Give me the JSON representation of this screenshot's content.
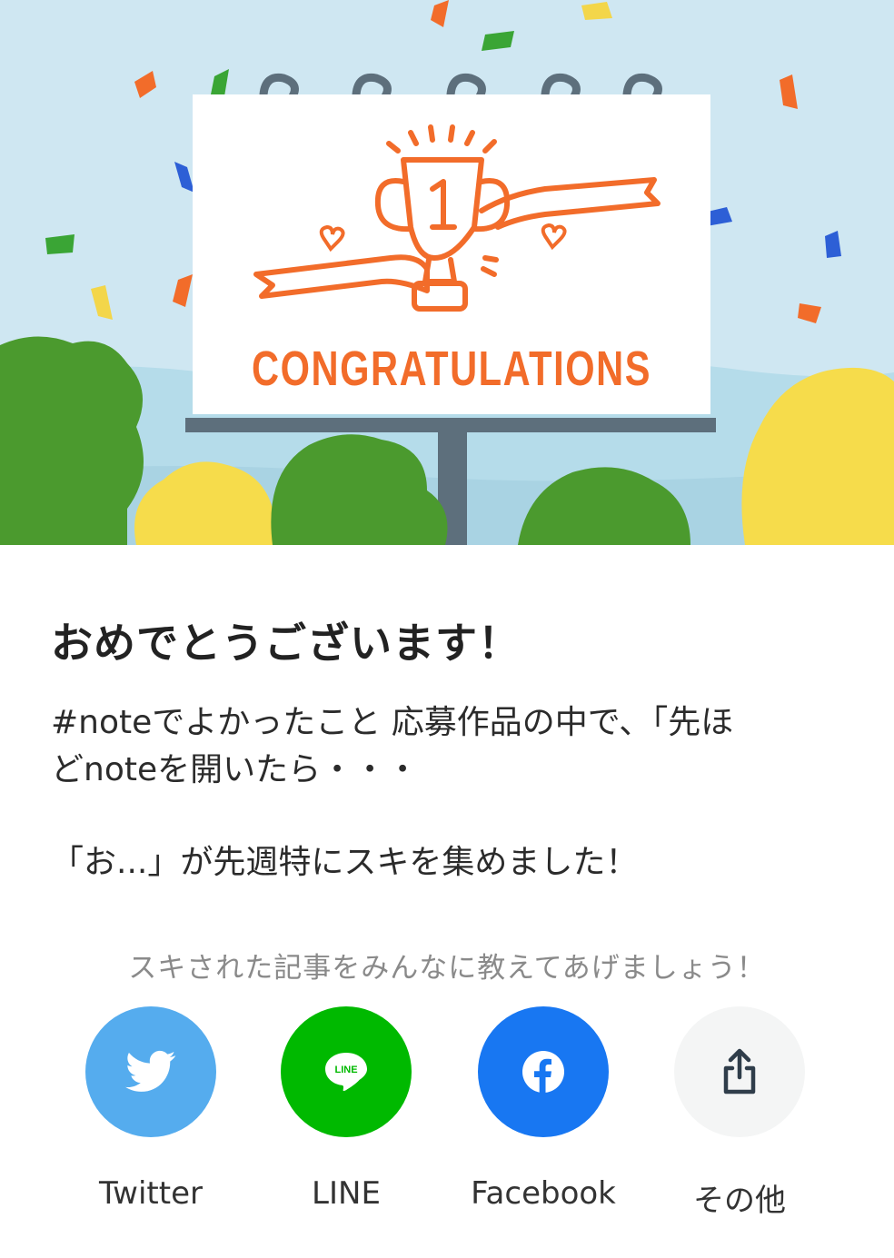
{
  "banner": {
    "illustration": "congratulations-billboard-trophy",
    "billboard_text": "CONGRATULATIONS",
    "trophy_number": "1",
    "colors": {
      "sky": "#cfe7f2",
      "accent_orange": "#f26c2a",
      "billboard": "#ffffff",
      "pole": "#5d6f7c",
      "tree_green": "#4b9a2e",
      "tree_yellow": "#f6dc4b"
    }
  },
  "dialog": {
    "title": "おめでとうございます！",
    "message_line1": "#noteでよかったこと 応募作品の中で、「先ほ",
    "message_line2": "どnoteを開いたら・・・",
    "message_line3": "「お...」が先週特にスキを集めました！"
  },
  "share": {
    "prompt": "スキされた記事をみんなに教えてあげましょう！",
    "buttons": [
      {
        "label": "Twitter",
        "icon": "twitter-bird-icon",
        "color": "#55acee"
      },
      {
        "label": "LINE",
        "icon": "line-icon",
        "color": "#00b900"
      },
      {
        "label": "Facebook",
        "icon": "facebook-icon",
        "color": "#1877f2"
      },
      {
        "label": "その他",
        "icon": "share-icon",
        "color": "#f4f5f5"
      }
    ]
  }
}
